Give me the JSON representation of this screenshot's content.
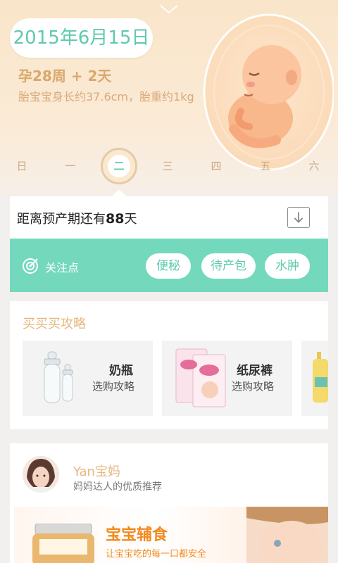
{
  "header": {
    "date": "2015年6月15日",
    "week": "孕28周 + 2天",
    "baby_size": "胎宝宝身长约37.6cm，胎重约1kg"
  },
  "weekdays": [
    "日",
    "一",
    "二",
    "三",
    "四",
    "五",
    "六"
  ],
  "selected_day": "二",
  "due": {
    "prefix": "距离预产期还有",
    "days": "88",
    "suffix": "天"
  },
  "focus": {
    "label": "关注点",
    "tags": [
      "便秘",
      "待产包",
      "水肿"
    ]
  },
  "buy_guide": {
    "title": "买买买攻略",
    "items": [
      {
        "name": "奶瓶",
        "sub": "选购攻略"
      },
      {
        "name": "纸尿裤",
        "sub": "选购攻略"
      }
    ]
  },
  "post": {
    "author": "Yan宝妈",
    "author_sub": "妈妈达人的优质推荐",
    "banner_title": "宝宝辅食",
    "banner_sub": "让宝宝吃的每一口都安全"
  },
  "colors": {
    "accent": "#74d8bd",
    "accent_text": "#5fc9ad",
    "gold": "#e6b77e"
  }
}
